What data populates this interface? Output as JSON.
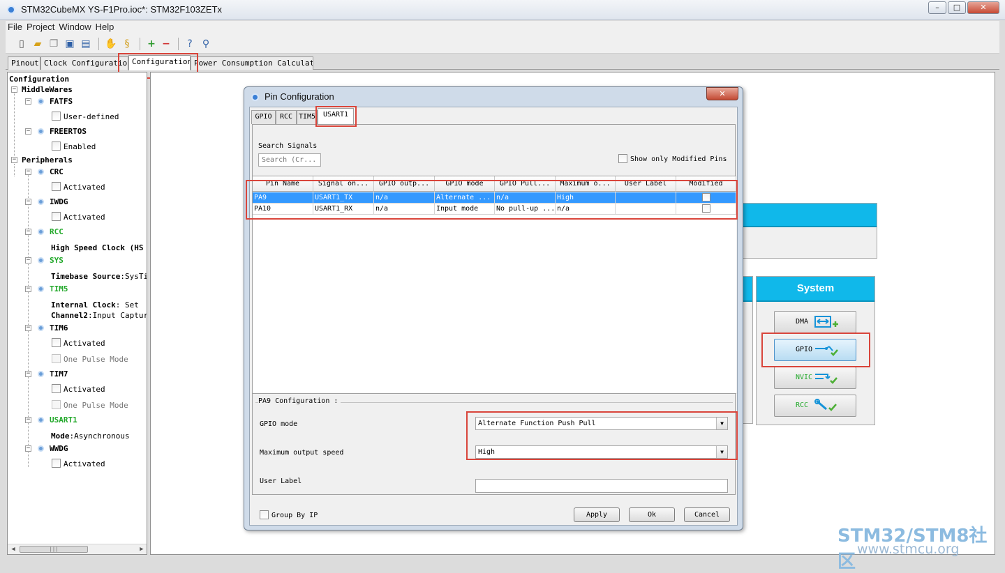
{
  "window": {
    "title": "STM32CubeMX YS-F1Pro.ioc*: STM32F103ZETx",
    "min": "–",
    "max": "□",
    "close": "✕"
  },
  "menu": [
    "File",
    "Project",
    "Window",
    "Help"
  ],
  "main_tabs": [
    "Pinout",
    "Clock Configuration",
    "Configuration",
    "Power Consumption Calculator"
  ],
  "tree": {
    "root": "Configuration",
    "middlewares": "MiddleWares",
    "fatfs": "FATFS",
    "fatfs_opt": "User-defined",
    "freertos": "FREERTOS",
    "freertos_opt": "Enabled",
    "peripherals": "Peripherals",
    "crc": "CRC",
    "crc_opt": "Activated",
    "iwdg": "IWDG",
    "iwdg_opt": "Activated",
    "rcc": "RCC",
    "rcc_key": "High Speed Clock (HS",
    "sys": "SYS",
    "sys_key": "Timebase Source",
    "sys_val": ":SysTi",
    "tim5": "TIM5",
    "tim5_key1": "Internal Clock",
    "tim5_val1": ": Set",
    "tim5_key2": "Channel2",
    "tim5_val2": ":Input Capture",
    "tim6": "TIM6",
    "tim6_opt1": "Activated",
    "tim6_opt2": "One Pulse Mode",
    "tim7": "TIM7",
    "tim7_opt1": "Activated",
    "tim7_opt2": "One Pulse Mode",
    "usart1": "USART1",
    "usart1_key": "Mode",
    "usart1_val": ":Asynchronous",
    "wwdg": "WWDG",
    "wwdg_opt": "Activated"
  },
  "system_panel": {
    "header": "System",
    "buttons": [
      "DMA",
      "GPIO",
      "NVIC",
      "RCC"
    ]
  },
  "dialog": {
    "title": "Pin Configuration",
    "tabs": [
      "GPIO",
      "RCC",
      "TIM5",
      "USART1"
    ],
    "search_label": "Search Signals",
    "search_placeholder": "Search (Cr...",
    "show_modified": "Show only Modified Pins",
    "columns": [
      "Pin Name",
      "Signal on...",
      "GPIO outp...",
      "GPIO mode",
      "GPIO Pull...",
      "Maximum o...",
      "User Label",
      "Modified"
    ],
    "rows": [
      [
        "PA9",
        "USART1_TX",
        "n/a",
        "Alternate ...",
        "n/a",
        "High",
        ""
      ],
      [
        "PA10",
        "USART1_RX",
        "n/a",
        "Input mode",
        "No pull-up ...",
        "n/a",
        ""
      ]
    ],
    "config_title": "PA9 Configuration :",
    "gpio_mode_label": "GPIO mode",
    "gpio_mode_value": "Alternate Function Push Pull",
    "max_speed_label": "Maximum output speed",
    "max_speed_value": "High",
    "user_label": "User Label",
    "group_by_ip": "Group By IP",
    "apply": "Apply",
    "ok": "Ok",
    "cancel": "Cancel"
  },
  "watermark": {
    "line1": "STM32/STM8社区",
    "line2": "www.stmcu.org"
  },
  "colors": {
    "accent_header": "#10b8ea",
    "highlight_box": "#d9453b",
    "row_selected": "#3399ff",
    "enabled_peripheral": "#22a82a"
  },
  "icons": {
    "toolbar": [
      "new-file-icon",
      "open-folder-icon",
      "copy-icon",
      "save-icon",
      "save-all-icon",
      "generate-code-icon",
      "report-icon",
      "add-icon",
      "remove-icon",
      "help-icon",
      "search-icon"
    ]
  }
}
